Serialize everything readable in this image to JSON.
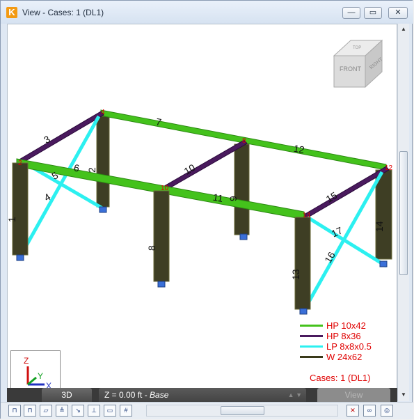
{
  "window": {
    "title": "View - Cases: 1 (DL1)",
    "app_icon": "K",
    "controls": {
      "minimize": "—",
      "restore": "▭",
      "close": "✕"
    }
  },
  "viewcube": {
    "front": "FRONT",
    "right": "RIGHT",
    "top": "TOP"
  },
  "members": {
    "m1": "1",
    "m2": "2",
    "m3": "3",
    "m4": "4",
    "m5": "5",
    "m6": "6",
    "m7": "7",
    "m8": "8",
    "m9": "9",
    "m10": "10",
    "m11": "11",
    "m12": "12",
    "m13": "13",
    "m14": "14",
    "m15": "15",
    "m16": "16",
    "m17": "17"
  },
  "nodes": {
    "n2": "2",
    "n4": "4",
    "n8": "8",
    "n10": "10",
    "n12": "12",
    "n14": "14"
  },
  "legend": [
    {
      "label": "HP 10x42",
      "color": "#44c21c"
    },
    {
      "label": "HP 8x36",
      "color": "#4a1a5e"
    },
    {
      "label": "LP 8x8x0.5",
      "color": "#2cf0f0"
    },
    {
      "label": "W 24x62",
      "color": "#3a3a1a"
    }
  ],
  "cases_label": "Cases: 1 (DL1)",
  "axes": {
    "z": "Z",
    "y": "Y",
    "x": "X"
  },
  "bottom_bar": {
    "tab_3d": "3D",
    "z_prefix": "Z = 0.00 ft - ",
    "z_level": "Base",
    "view": "View"
  },
  "toolbar": {
    "icons": [
      "node-icon",
      "member-icon",
      "plate-icon",
      "support-icon",
      "load-icon",
      "axis-icon",
      "grid-icon",
      "numbering-icon"
    ],
    "right_icons": [
      "delete-view-icon",
      "link-icon",
      "glasses-icon"
    ]
  }
}
